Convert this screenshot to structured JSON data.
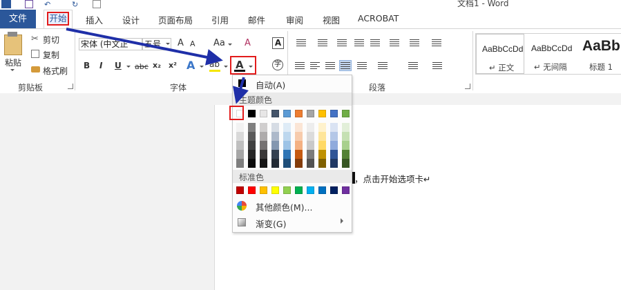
{
  "titlebar": {
    "title": "文档1 - Word"
  },
  "tabs": [
    {
      "key": "file",
      "label": "文件"
    },
    {
      "key": "home",
      "label": "开始"
    },
    {
      "key": "insert",
      "label": "插入"
    },
    {
      "key": "design",
      "label": "设计"
    },
    {
      "key": "layout",
      "label": "页面布局"
    },
    {
      "key": "references",
      "label": "引用"
    },
    {
      "key": "mailings",
      "label": "邮件"
    },
    {
      "key": "review",
      "label": "审阅"
    },
    {
      "key": "view",
      "label": "视图"
    },
    {
      "key": "acrobat",
      "label": "ACROBAT"
    }
  ],
  "clipboard": {
    "paste_label": "粘贴",
    "cut_label": "剪切",
    "copy_label": "复制",
    "format_painter_label": "格式刷",
    "group_label": "剪贴板"
  },
  "font": {
    "font_name": "宋体 (中文正",
    "font_size": "五号",
    "grow": "A",
    "shrink": "A",
    "change_case": "Aa",
    "clear_format": "A",
    "bold": "B",
    "italic": "I",
    "underline": "U",
    "strikethrough": "abc",
    "subscript": "x₂",
    "superscript": "x²",
    "font_color_letter": "A",
    "highlight_label": "ab",
    "group_label": "字体"
  },
  "paragraph": {
    "group_label": "段落"
  },
  "styles": [
    {
      "sample": "AaBbCcDd",
      "name": "↵ 正文"
    },
    {
      "sample": "AaBbCcDd",
      "name": "↵ 无间隔"
    },
    {
      "sample": "AaBb",
      "name": "标题 1"
    }
  ],
  "document": {
    "text": "，点击开始选项卡↵"
  },
  "font_color_menu": {
    "auto_label": "自动(A)",
    "theme_colors_label": "主题颜色",
    "standard_colors_label": "标准色",
    "more_colors_label": "其他颜色(M)...",
    "gradient_label": "渐变(G)",
    "theme_colors": [
      "#ffffff",
      "#000000",
      "#e7e6e6",
      "#44546a",
      "#5b9bd5",
      "#ed7d31",
      "#a5a5a5",
      "#ffc000",
      "#4472c4",
      "#70ad47"
    ],
    "theme_shades": [
      [
        "#f2f2f2",
        "#d9d9d9",
        "#bfbfbf",
        "#a6a6a6",
        "#7f7f7f"
      ],
      [
        "#7f7f7f",
        "#595959",
        "#404040",
        "#262626",
        "#0d0d0d"
      ],
      [
        "#d0cece",
        "#aeabab",
        "#757171",
        "#3a3838",
        "#171616"
      ],
      [
        "#d6dce4",
        "#adb9ca",
        "#8497b0",
        "#333f4f",
        "#222a35"
      ],
      [
        "#deebf6",
        "#bdd7ee",
        "#9dc3e6",
        "#2e75b5",
        "#1e4e79"
      ],
      [
        "#fbe5d5",
        "#f7cbac",
        "#f4b183",
        "#c55a11",
        "#833c0b"
      ],
      [
        "#ededed",
        "#dbdbdb",
        "#c9c9c9",
        "#7b7b7b",
        "#525252"
      ],
      [
        "#fff2cc",
        "#fee599",
        "#ffd965",
        "#bf9000",
        "#7f6000"
      ],
      [
        "#dae3f3",
        "#b4c7e7",
        "#8faadc",
        "#2f5496",
        "#1f3864"
      ],
      [
        "#e2efd9",
        "#c5e0b3",
        "#a8d08d",
        "#538135",
        "#375623"
      ]
    ],
    "standard_colors": [
      "#c00000",
      "#ff0000",
      "#ffc000",
      "#ffff00",
      "#92d050",
      "#00b050",
      "#00b0f0",
      "#0070c0",
      "#002060",
      "#7030a0"
    ]
  },
  "colors": {
    "accent": "#2b579a",
    "highlight_red": "#e21b1b",
    "arrow_blue": "#1f2fa8"
  }
}
